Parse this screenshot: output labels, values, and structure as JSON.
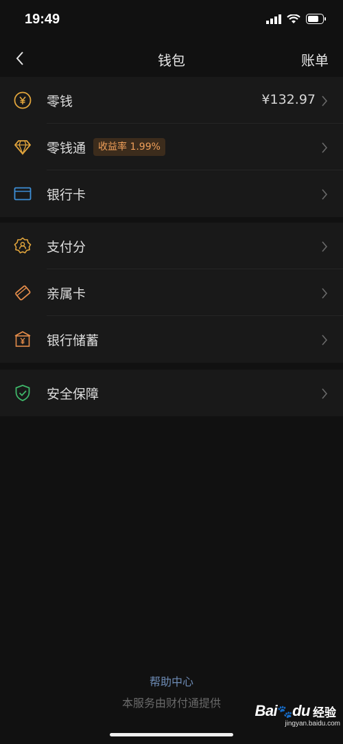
{
  "status_bar": {
    "time": "19:49",
    "icons": [
      "signal-icon",
      "wifi-icon",
      "battery-icon"
    ]
  },
  "nav": {
    "title": "钱包",
    "right_label": "账单",
    "back_icon": "chevron-left-icon"
  },
  "groups": [
    {
      "rows": [
        {
          "label": "零钱",
          "value": "¥132.97",
          "icon": "yuan-coin-icon"
        },
        {
          "label": "零钱通",
          "badge": "收益率 1.99%",
          "icon": "diamond-icon"
        },
        {
          "label": "银行卡",
          "icon": "bank-card-icon"
        }
      ]
    },
    {
      "rows": [
        {
          "label": "支付分",
          "icon": "pay-score-icon"
        },
        {
          "label": "亲属卡",
          "icon": "family-card-icon"
        },
        {
          "label": "银行储蓄",
          "icon": "bank-savings-icon"
        }
      ]
    },
    {
      "rows": [
        {
          "label": "安全保障",
          "icon": "shield-check-icon"
        }
      ]
    }
  ],
  "footer": {
    "help_link": "帮助中心",
    "note": "本服务由财付通提供"
  },
  "watermark": {
    "logo": "Bai",
    "logo_end": "du",
    "text": "经验",
    "sub": "jingyan.baidu.com"
  },
  "colors": {
    "background": "#111111",
    "row_bg": "#191919",
    "accent_gold": "#e2a53c",
    "accent_orange": "#e48c4a",
    "accent_blue": "#3d8fd8",
    "accent_green": "#3fb86a",
    "badge_text": "#f0a05a",
    "link": "#6d8bb5"
  }
}
